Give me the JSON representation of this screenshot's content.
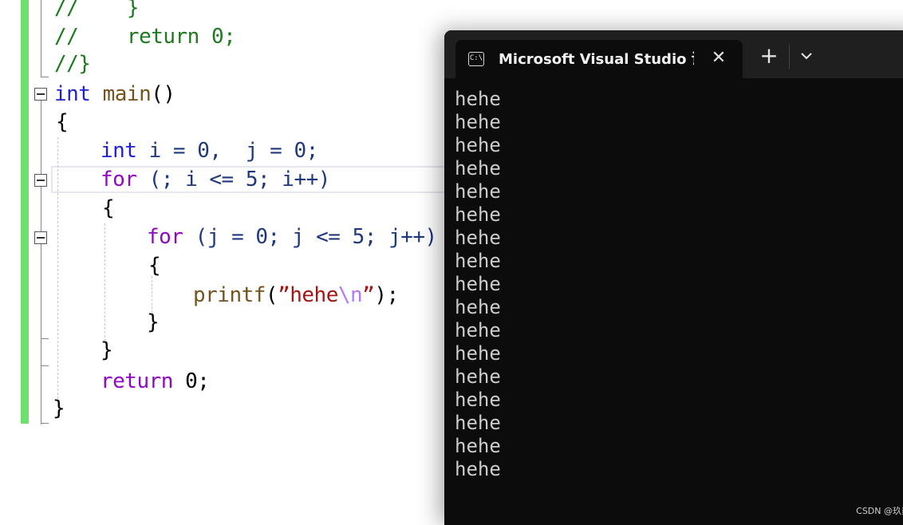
{
  "editor": {
    "comment_lines": [
      "//    }",
      "//    return 0;",
      "//}"
    ],
    "code": {
      "l1_kw": "int",
      "l1_fn": "main",
      "l1_rest": "()",
      "l2": "{",
      "l3_kw": "int",
      "l3_rest": " i = 0,  j = 0;",
      "l4_kw": "for",
      "l4_rest": " (; i <= 5; i++)",
      "l5": "{",
      "l6_kw": "for",
      "l6_rest": " (j = 0; j <= 5; j++)",
      "l7": "{",
      "l8_fn": "printf",
      "l8_open": "(",
      "l8_str": "”hehe",
      "l8_esc": "\\n",
      "l8_strend": "”",
      "l8_close": ");",
      "l9": "}",
      "l10": "}",
      "l11_kw": "return",
      "l11_rest": " 0;",
      "l12": "}"
    }
  },
  "terminal": {
    "tab_title": "Microsoft Visual Studio 调试控制台",
    "icon_text": "C:\\",
    "close_glyph": "✕",
    "new_tab_glyph": "+",
    "output": [
      "hehe",
      "hehe",
      "hehe",
      "hehe",
      "hehe",
      "hehe",
      "hehe",
      "hehe",
      "hehe",
      "hehe",
      "hehe",
      "hehe",
      "hehe",
      "hehe",
      "hehe",
      "hehe",
      "hehe"
    ]
  },
  "watermark": "CSDN @玖剡",
  "colors": {
    "keyword": "#1f1fd6",
    "control_keyword": "#8f08c4",
    "comment": "#1e7a1e",
    "function": "#74531f",
    "string": "#a31515",
    "change_bar": "#6ee06e",
    "terminal_bg": "#0c0c0c"
  }
}
